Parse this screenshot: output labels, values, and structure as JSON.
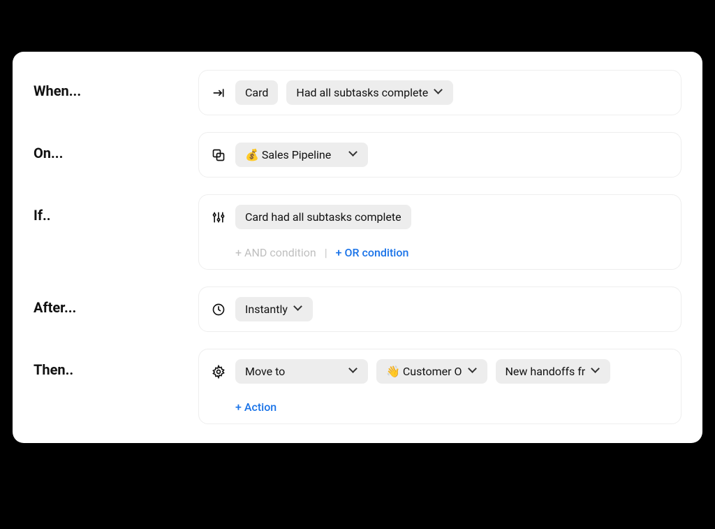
{
  "rows": {
    "when": {
      "label": "When...",
      "entity": "Card",
      "trigger": "Had all subtasks complete"
    },
    "on": {
      "label": "On...",
      "board": "💰 Sales Pipeline"
    },
    "if": {
      "label": "If..",
      "condition": "Card had all subtasks complete",
      "add_and": "+ AND condition",
      "divider": "|",
      "add_or": "+ OR condition"
    },
    "after": {
      "label": "After...",
      "timing": "Instantly"
    },
    "then": {
      "label": "Then..",
      "action": "Move to",
      "target_board": "👋 Customer O",
      "target_list": "New handoffs fr",
      "add_action": "+ Action"
    }
  }
}
